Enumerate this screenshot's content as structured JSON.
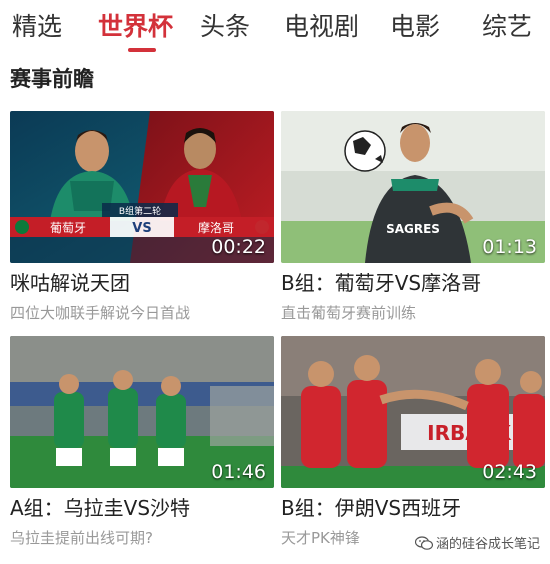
{
  "tabs": [
    {
      "label": "精选"
    },
    {
      "label": "世界杯"
    },
    {
      "label": "头条"
    },
    {
      "label": "电视剧"
    },
    {
      "label": "电影"
    },
    {
      "label": "综艺"
    }
  ],
  "active_tab": "世界杯",
  "section": {
    "title": "赛事前瞻"
  },
  "cards": [
    {
      "title": "咪咕解说天团",
      "subtitle": "四位大咖联手解说今日首战",
      "duration": "00:22",
      "overlay": {
        "round": "B组第二轮",
        "team_left": "葡萄牙",
        "vs": "VS",
        "team_right": "摩洛哥"
      }
    },
    {
      "title": "B组：葡萄牙VS摩洛哥",
      "subtitle": "直击葡萄牙赛前训练",
      "duration": "01:13",
      "overlay": {
        "jersey": "SAGRES"
      }
    },
    {
      "title": "A组：乌拉圭VS沙特",
      "subtitle": "乌拉圭提前出线可期?",
      "duration": "01:46"
    },
    {
      "title": "B组：伊朗VS西班牙",
      "subtitle": "天才PK神锋",
      "duration": "02:43",
      "overlay": {
        "board": "IRBACK"
      }
    }
  ],
  "watermark": {
    "text": "涵的硅谷成长笔记",
    "icon": "wechat-icon"
  },
  "colors": {
    "accent": "#d3313a",
    "text": "#222222",
    "subtext": "#999999"
  }
}
